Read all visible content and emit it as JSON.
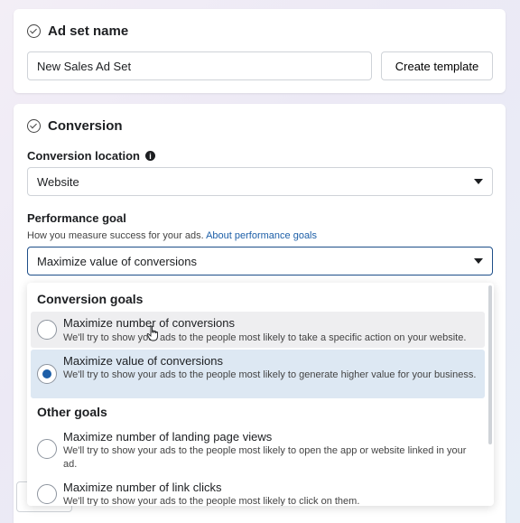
{
  "ad_set": {
    "title": "Ad set name",
    "name_value": "New Sales Ad Set",
    "create_template_label": "Create template"
  },
  "conversion": {
    "title": "Conversion",
    "location_label": "Conversion location",
    "location_value": "Website",
    "goal_label": "Performance goal",
    "goal_helper": "How you measure success for your ads.",
    "goal_helper_link": "About performance goals",
    "goal_value": "Maximize value of conversions"
  },
  "dropdown": {
    "group1_title": "Conversion goals",
    "group2_title": "Other goals",
    "options": [
      {
        "title": "Maximize number of conversions",
        "desc": "We'll try to show your ads to the people most likely to take a specific action on your website.",
        "selected": false
      },
      {
        "title": "Maximize value of conversions",
        "desc": "We'll try to show your ads to the people most likely to generate higher value for your business.",
        "selected": true
      },
      {
        "title": "Maximize number of landing page views",
        "desc": "We'll try to show your ads to the people most likely to open the app or website linked in your ad.",
        "selected": false
      },
      {
        "title": "Maximize number of link clicks",
        "desc": "We'll try to show your ads to the people most likely to click on them.",
        "selected": false
      }
    ]
  },
  "colors": {
    "accent": "#1d5fa8",
    "selected_bg": "#dde8f3"
  }
}
